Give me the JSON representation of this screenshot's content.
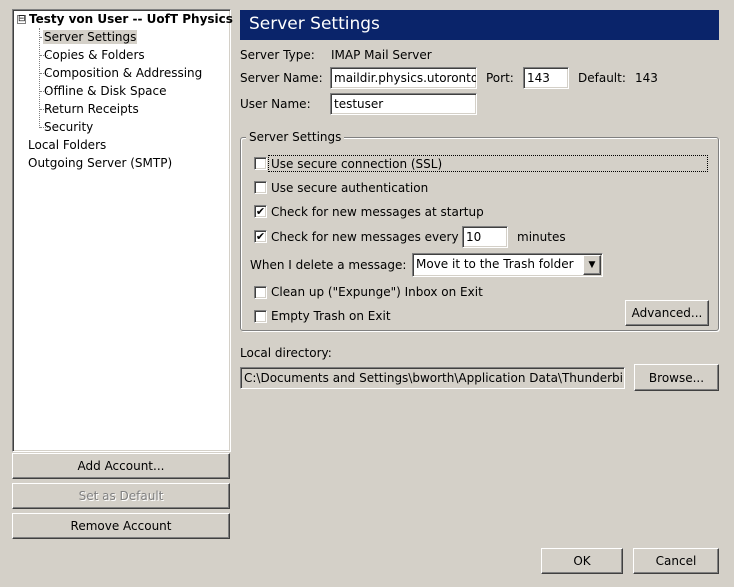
{
  "tree": {
    "account": "Testy von User -- UofT Physics",
    "expander": "⊟",
    "children": [
      "Server Settings",
      "Copies & Folders",
      "Composition & Addressing",
      "Offline & Disk Space",
      "Return Receipts",
      "Security"
    ],
    "local_folders": "Local Folders",
    "outgoing": "Outgoing Server (SMTP)"
  },
  "left_buttons": {
    "add": "Add Account...",
    "set_default": "Set as Default",
    "remove": "Remove Account"
  },
  "panel": {
    "title": "Server Settings",
    "server_type_label": "Server Type:",
    "server_type_value": "IMAP Mail Server",
    "server_name_label": "Server Name:",
    "server_name_value": "maildir.physics.utoronto.ca",
    "port_label": "Port:",
    "port_value": "143",
    "default_label": "Default:",
    "default_value": "143",
    "user_name_label": "User Name:",
    "user_name_value": "testuser"
  },
  "group": {
    "legend": "Server Settings",
    "ssl": {
      "label": "Use secure connection (SSL)",
      "checked": false
    },
    "secure_auth": {
      "label": "Use secure authentication",
      "checked": false
    },
    "check_startup": {
      "label": "Check for new messages at startup",
      "checked": true
    },
    "check_every": {
      "label": "Check for new messages every",
      "checked": true,
      "value": "10",
      "unit": "minutes"
    },
    "delete_label": "When I delete a message:",
    "delete_value": "Move it to the Trash folder",
    "cleanup": {
      "label": "Clean up (\"Expunge\") Inbox on Exit",
      "checked": false
    },
    "empty_trash": {
      "label": "Empty Trash on Exit",
      "checked": false
    },
    "advanced": "Advanced..."
  },
  "local_dir": {
    "label": "Local directory:",
    "value": "C:\\Documents and Settings\\bworth\\Application Data\\Thunderbird\\Profiles",
    "browse": "Browse..."
  },
  "dialog": {
    "ok": "OK",
    "cancel": "Cancel"
  }
}
